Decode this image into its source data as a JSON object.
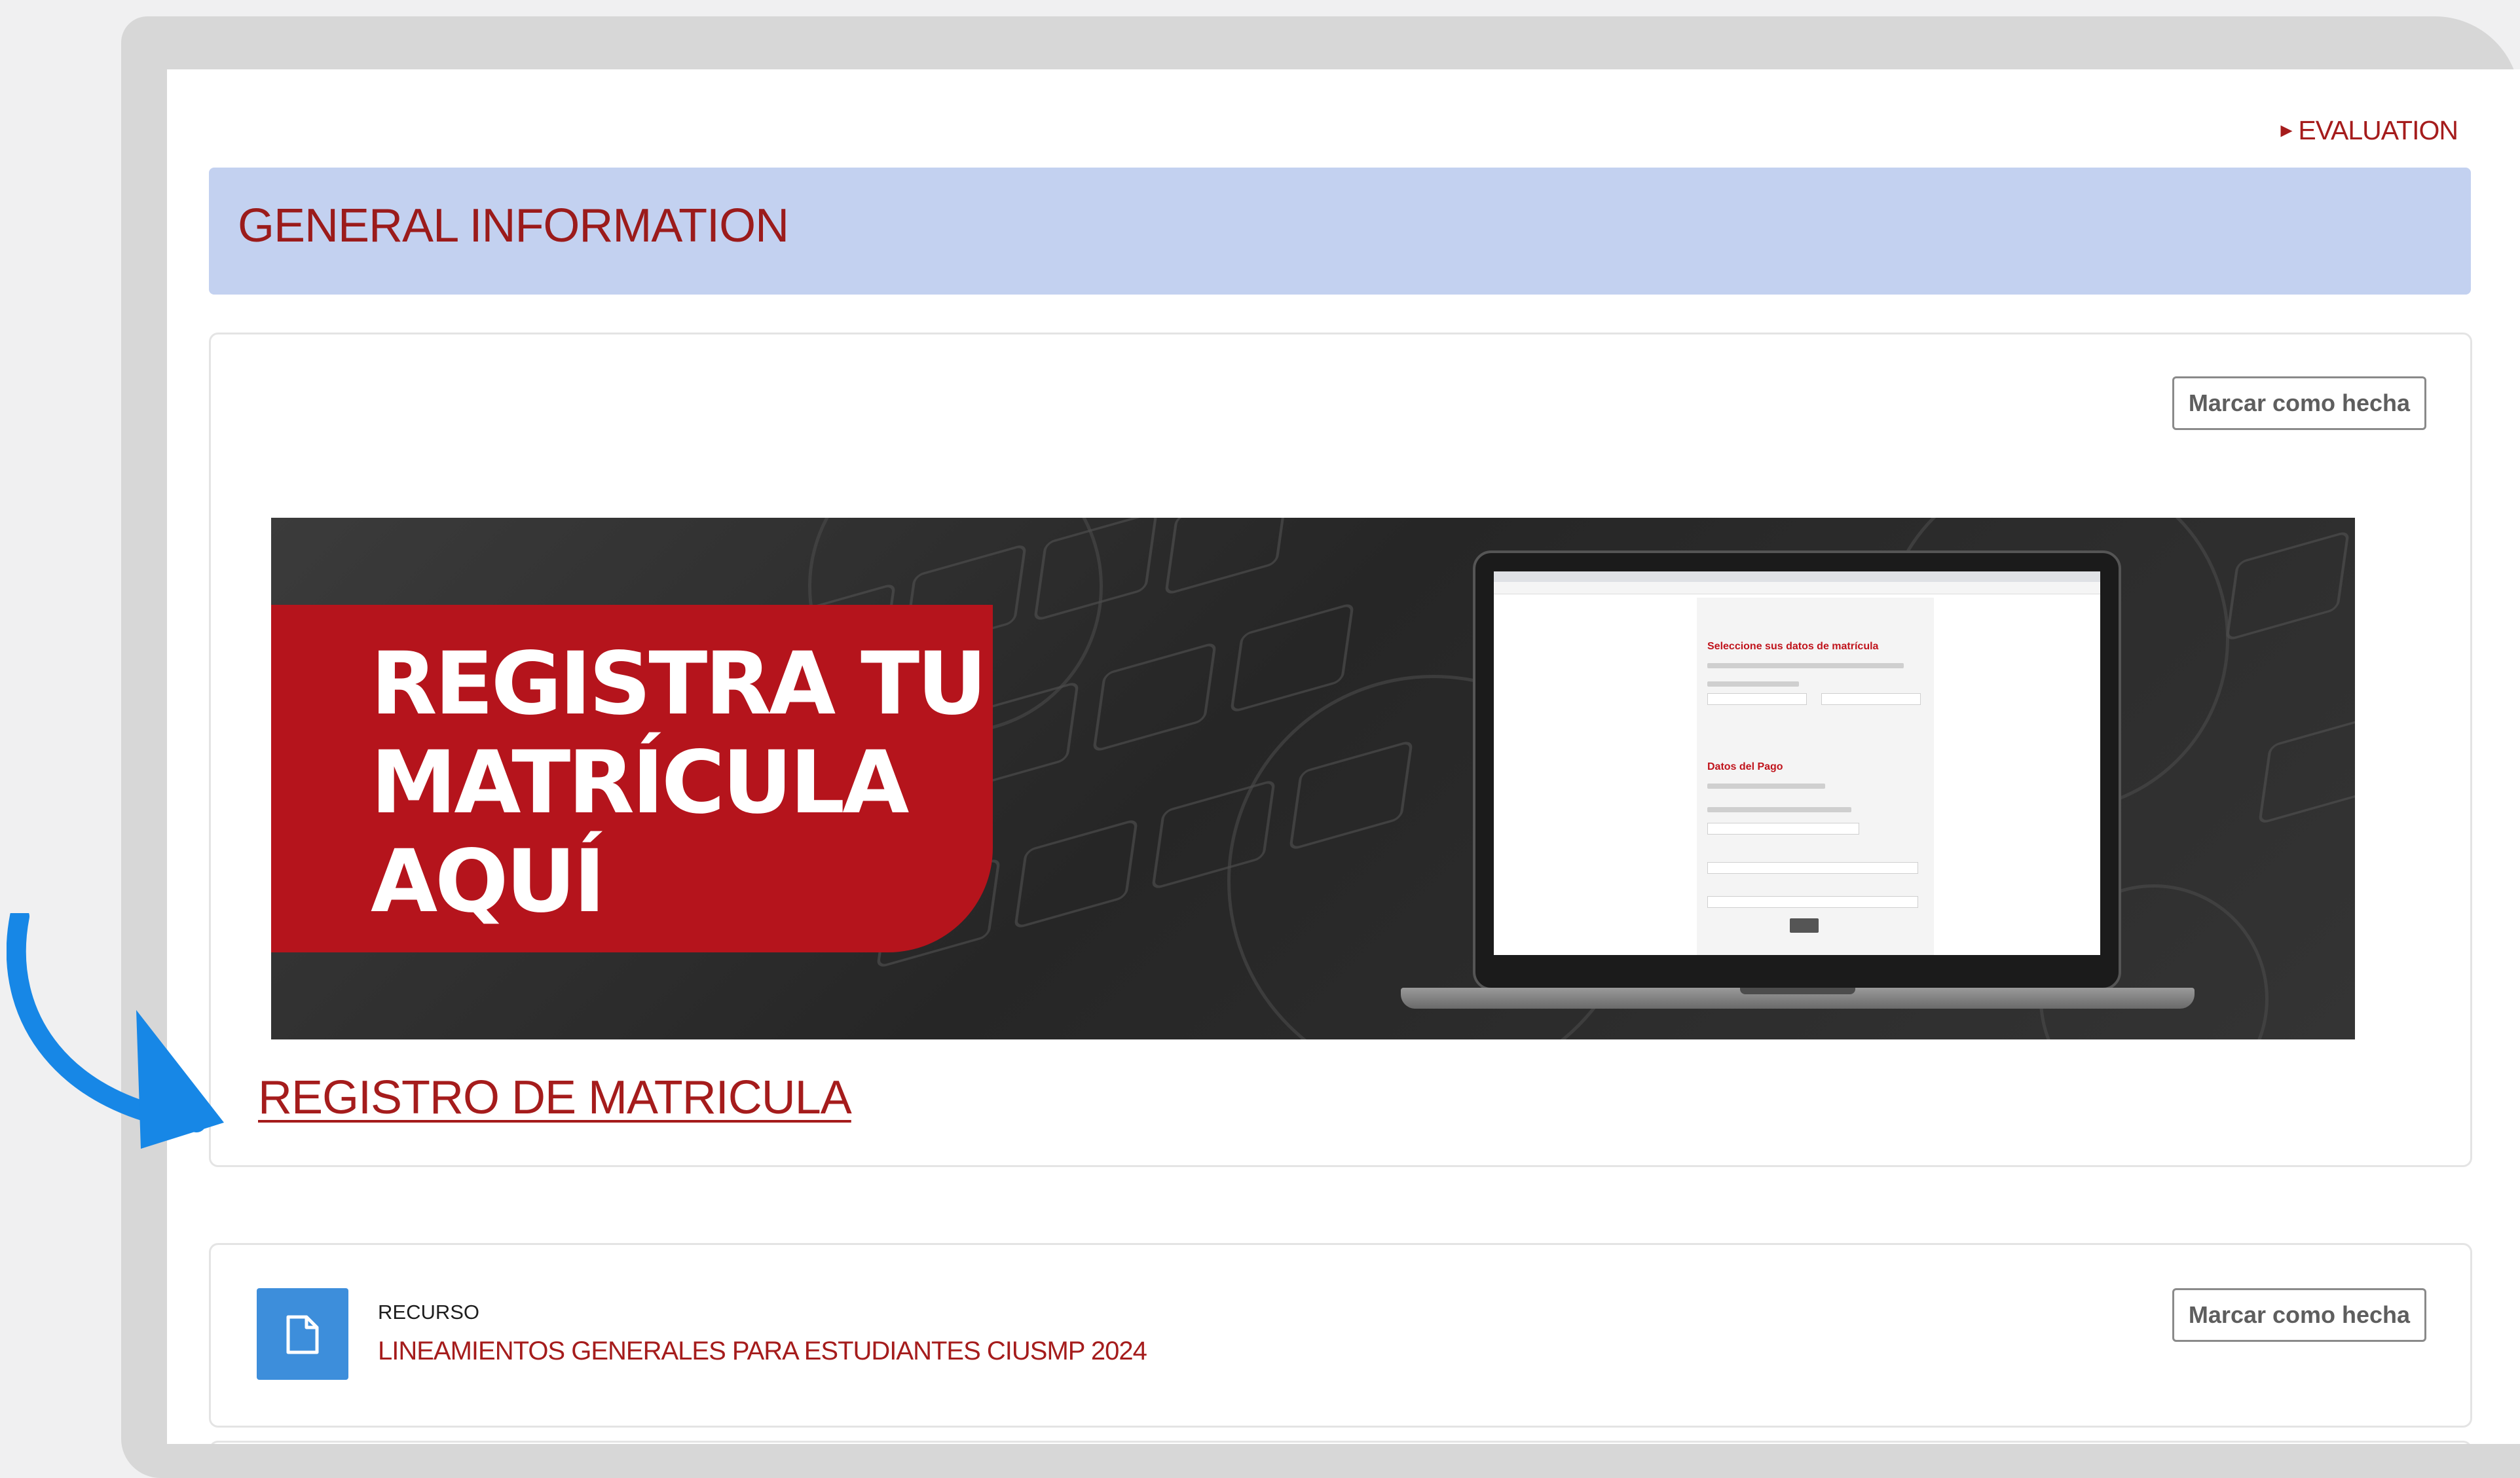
{
  "header": {
    "nav_link": "EVALUATION",
    "nav_arrow": "►"
  },
  "section": {
    "title": "GENERAL INFORMATION"
  },
  "card1": {
    "mark_button": "Marcar como hecha",
    "banner": {
      "line1": "REGISTRA TU",
      "line2": "MATRÍCULA",
      "line3": "AQUÍ",
      "laptop_form_title": "Seleccione sus datos de matrícula",
      "laptop_form_payment_title": "Datos del Pago"
    },
    "link": "REGISTRO DE MATRICULA"
  },
  "card2": {
    "resource_type": "RECURSO",
    "resource_title": "LINEAMIENTOS GENERALES PARA ESTUDIANTES CIUSMP 2024",
    "mark_button": "Marcar como hecha",
    "icon": "file-icon"
  },
  "colors": {
    "accent_red": "#a51c1c",
    "header_bg": "#c3d1f0",
    "banner_red": "#b5141c",
    "icon_blue": "#3d8edb",
    "arrow_blue": "#1787e6"
  }
}
